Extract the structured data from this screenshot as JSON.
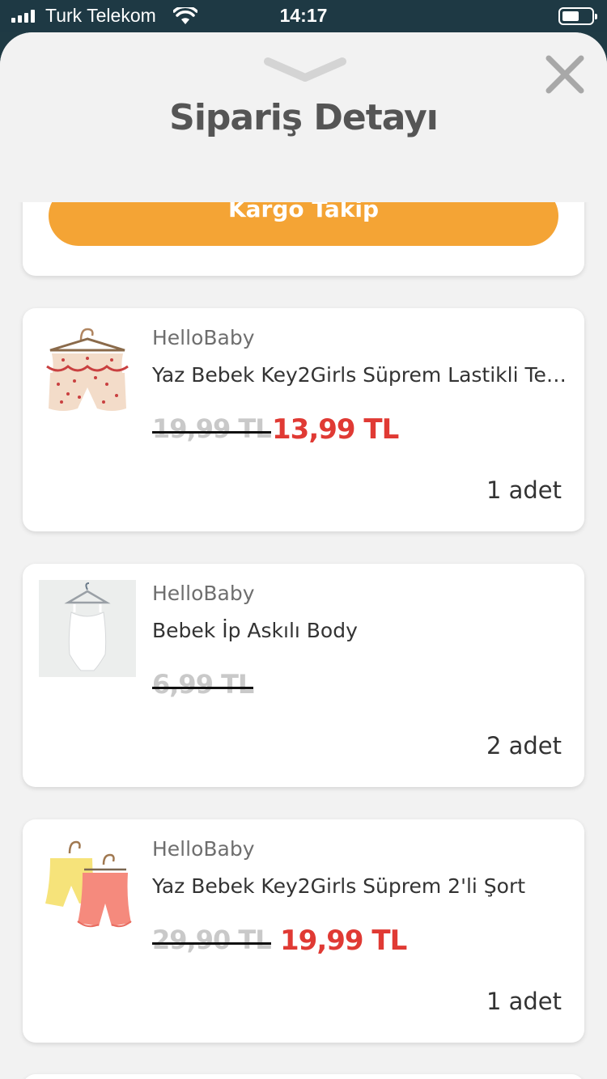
{
  "status_bar": {
    "carrier": "Turk Telekom",
    "time": "14:17",
    "battery_level": 0.45
  },
  "header": {
    "title": "Sipariş Detayı"
  },
  "tracking": {
    "button_label": "Kargo Takip",
    "accent_color": "#f4a435"
  },
  "products": [
    {
      "brand": "HelloBaby",
      "name": "Yaz Bebek Key2Girls Süprem Lastikli Tek...",
      "old_price": "19,99 TL",
      "new_price": "13,99 TL",
      "quantity": "1 adet"
    },
    {
      "brand": "HelloBaby",
      "name": "Bebek İp Askılı Body",
      "old_price": "6,99 TL",
      "new_price": "",
      "quantity": "2 adet"
    },
    {
      "brand": "HelloBaby",
      "name": "Yaz Bebek Key2Girls Süprem 2'li Şort",
      "old_price": "29,90 TL",
      "new_price": "19,99 TL",
      "quantity": "1 adet"
    }
  ],
  "colors": {
    "sale_price": "#e03a34",
    "background": "#f2f2f2"
  }
}
